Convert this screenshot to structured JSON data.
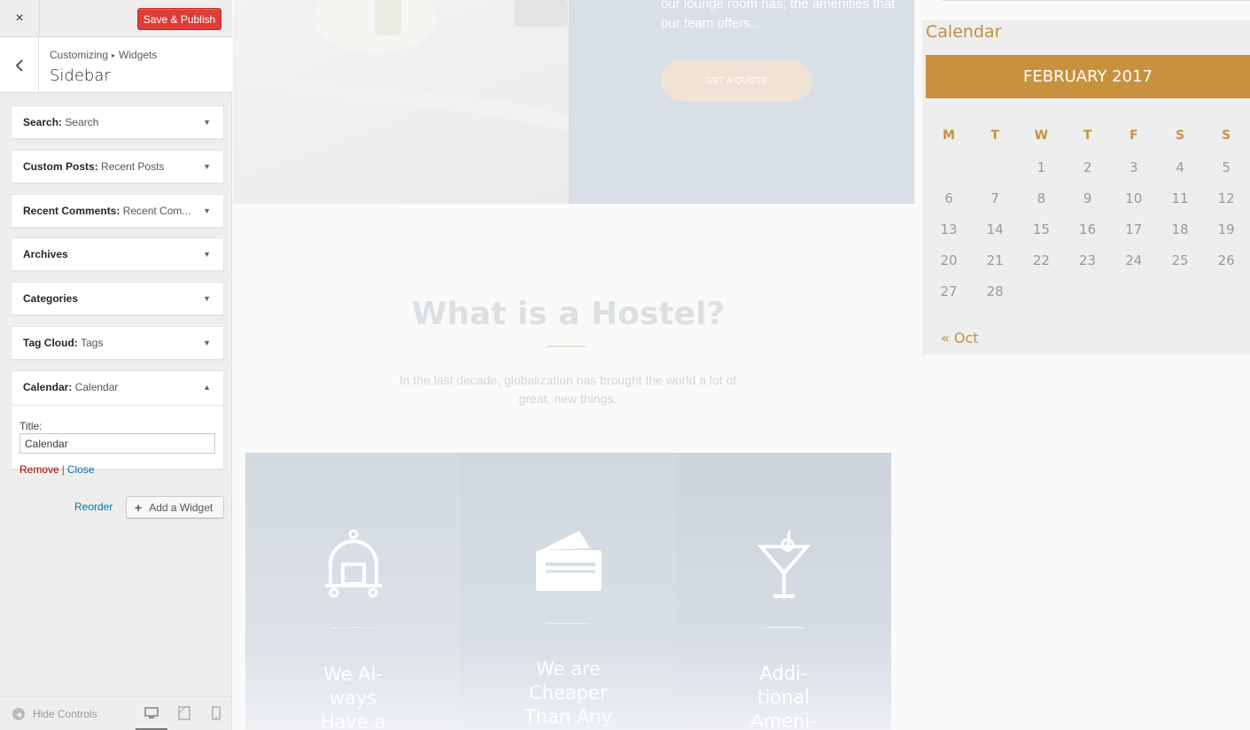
{
  "customizer": {
    "close_icon": "×",
    "publish_label": "Save & Publish",
    "breadcrumb": {
      "parent": "Customizing",
      "separator": "▸",
      "current": "Widgets"
    },
    "section_title": "Sidebar",
    "widgets": [
      {
        "name": "Search",
        "title": "Search"
      },
      {
        "name": "Custom Posts",
        "title": "Recent Posts"
      },
      {
        "name": "Recent Comments",
        "title": "Recent Com..."
      },
      {
        "name": "Archives",
        "title": ""
      },
      {
        "name": "Categories",
        "title": ""
      },
      {
        "name": "Tag Cloud",
        "title": "Tags"
      }
    ],
    "open_widget": {
      "name": "Calendar",
      "title": "Calendar",
      "field_label": "Title:",
      "field_value": "Calendar",
      "remove_label": "Remove",
      "separator": "|",
      "close_label": "Close"
    },
    "reorder_label": "Reorder",
    "add_widget_label": "Add a Widget",
    "hide_controls_label": "Hide Controls",
    "devices": [
      "desktop-icon",
      "tablet-icon",
      "mobile-icon"
    ],
    "accent": "#dd3d36",
    "link_color": "#0073aa"
  },
  "preview": {
    "hero_text_line1": "our lounge room has, the amenities that",
    "hero_text_line2": "our team offers...",
    "quote_button": "GET A QUOTE",
    "section_title": "What is a Hostel?",
    "section_text": "In the last decade, globalization has brought the world a lot of great, new things.",
    "features": [
      {
        "icon": "luggage-trolley-icon",
        "title_lines": [
          "We Al-",
          "ways",
          "Have a"
        ]
      },
      {
        "icon": "wallet-icon",
        "title_lines": [
          "We are",
          "Cheaper",
          "Than Any"
        ]
      },
      {
        "icon": "cocktail-icon",
        "title_lines": [
          "Addi-",
          "tional",
          "Ameni-"
        ]
      }
    ],
    "calendar": {
      "widget_title": "Calendar",
      "month": "FEBRUARY 2017",
      "days_of_week": [
        "M",
        "T",
        "W",
        "T",
        "F",
        "S",
        "S"
      ],
      "weeks": [
        [
          "",
          "",
          "1",
          "2",
          "3",
          "4",
          "5"
        ],
        [
          "6",
          "7",
          "8",
          "9",
          "10",
          "11",
          "12"
        ],
        [
          "13",
          "14",
          "15",
          "16",
          "17",
          "18",
          "19"
        ],
        [
          "20",
          "21",
          "22",
          "23",
          "24",
          "25",
          "26"
        ],
        [
          "27",
          "28",
          "",
          "",
          "",
          "",
          ""
        ]
      ],
      "prev_link": "« Oct",
      "accent": "#c8913e"
    }
  }
}
